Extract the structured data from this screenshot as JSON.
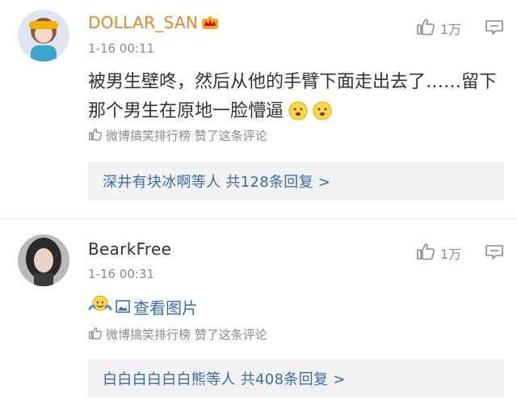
{
  "comments": [
    {
      "username": "DOLLAR_SAN",
      "time": "1-16 00:11",
      "likes": "1万",
      "text": "被男生壁咚，然后从他的手臂下面走出去了……留下那个男生在原地一脸懵逼",
      "source_text": "微博搞笑排行榜 赞了这条评论",
      "replies_text": "深井有块冰啊等人 共128条回复 >"
    },
    {
      "username": "BearkFree",
      "time": "1-16 00:31",
      "likes": "1万",
      "image_link_text": "查看图片",
      "source_text": "微博搞笑排行榜 赞了这条评论",
      "replies_text": "白白白白白白熊等人 共408条回复 >"
    }
  ],
  "colors": {
    "username_vip": "#e8862c",
    "link_blue": "#3b6ca8",
    "muted_gray": "#8a8a8a",
    "reply_bg": "#f2f2f2"
  },
  "icons": [
    "crown-badge-icon",
    "thumbs-up-icon",
    "comment-icon",
    "face-emoji-icon",
    "image-icon"
  ]
}
